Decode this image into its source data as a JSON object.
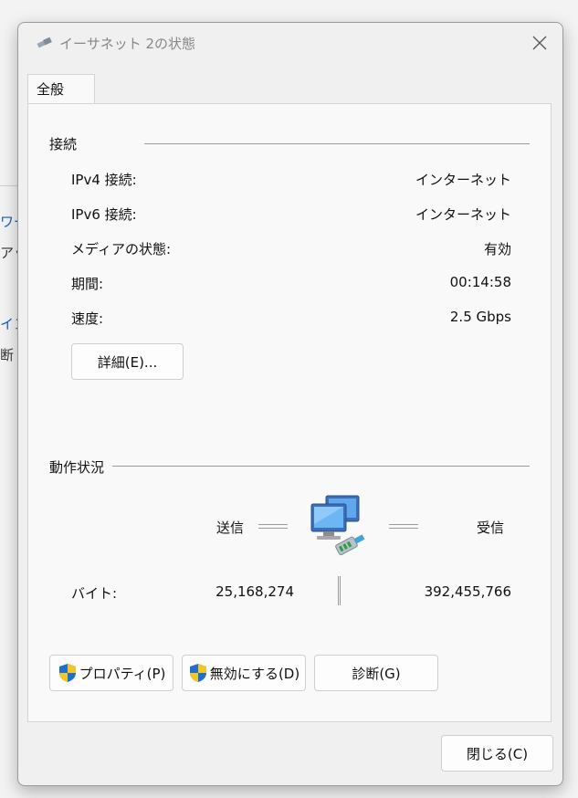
{
  "background": {
    "fragments": [
      "ワー",
      "アッ",
      "イン",
      "断"
    ]
  },
  "dialog": {
    "title": "イーサネット 2の状態",
    "close_glyph": "✕"
  },
  "tab": {
    "label": "全般"
  },
  "connection": {
    "title": "接続",
    "rows": [
      {
        "label": "IPv4 接続:",
        "value": "インターネット"
      },
      {
        "label": "IPv6 接続:",
        "value": "インターネット"
      },
      {
        "label": "メディアの状態:",
        "value": "有効"
      },
      {
        "label": "期間:",
        "value": "00:14:58"
      },
      {
        "label": "速度:",
        "value": "2.5 Gbps"
      }
    ],
    "details_button": "詳細(E)..."
  },
  "activity": {
    "title": "動作状況",
    "sent_label": "送信",
    "received_label": "受信",
    "bytes_label": "バイト:",
    "bytes_sent": "25,168,274",
    "bytes_received": "392,455,766",
    "icon": "network-computers-icon"
  },
  "buttons": {
    "properties": "プロパティ(P)",
    "disable": "無効にする(D)",
    "diagnose": "診断(G)",
    "close": "閉じる(C)"
  },
  "colors": {
    "dialog_bg": "#f0f0f0",
    "panel_bg": "#f9f9f9",
    "shield_blue": "#1f6fd1",
    "shield_yellow": "#f3c623",
    "link_blue": "#1a5fb4"
  }
}
